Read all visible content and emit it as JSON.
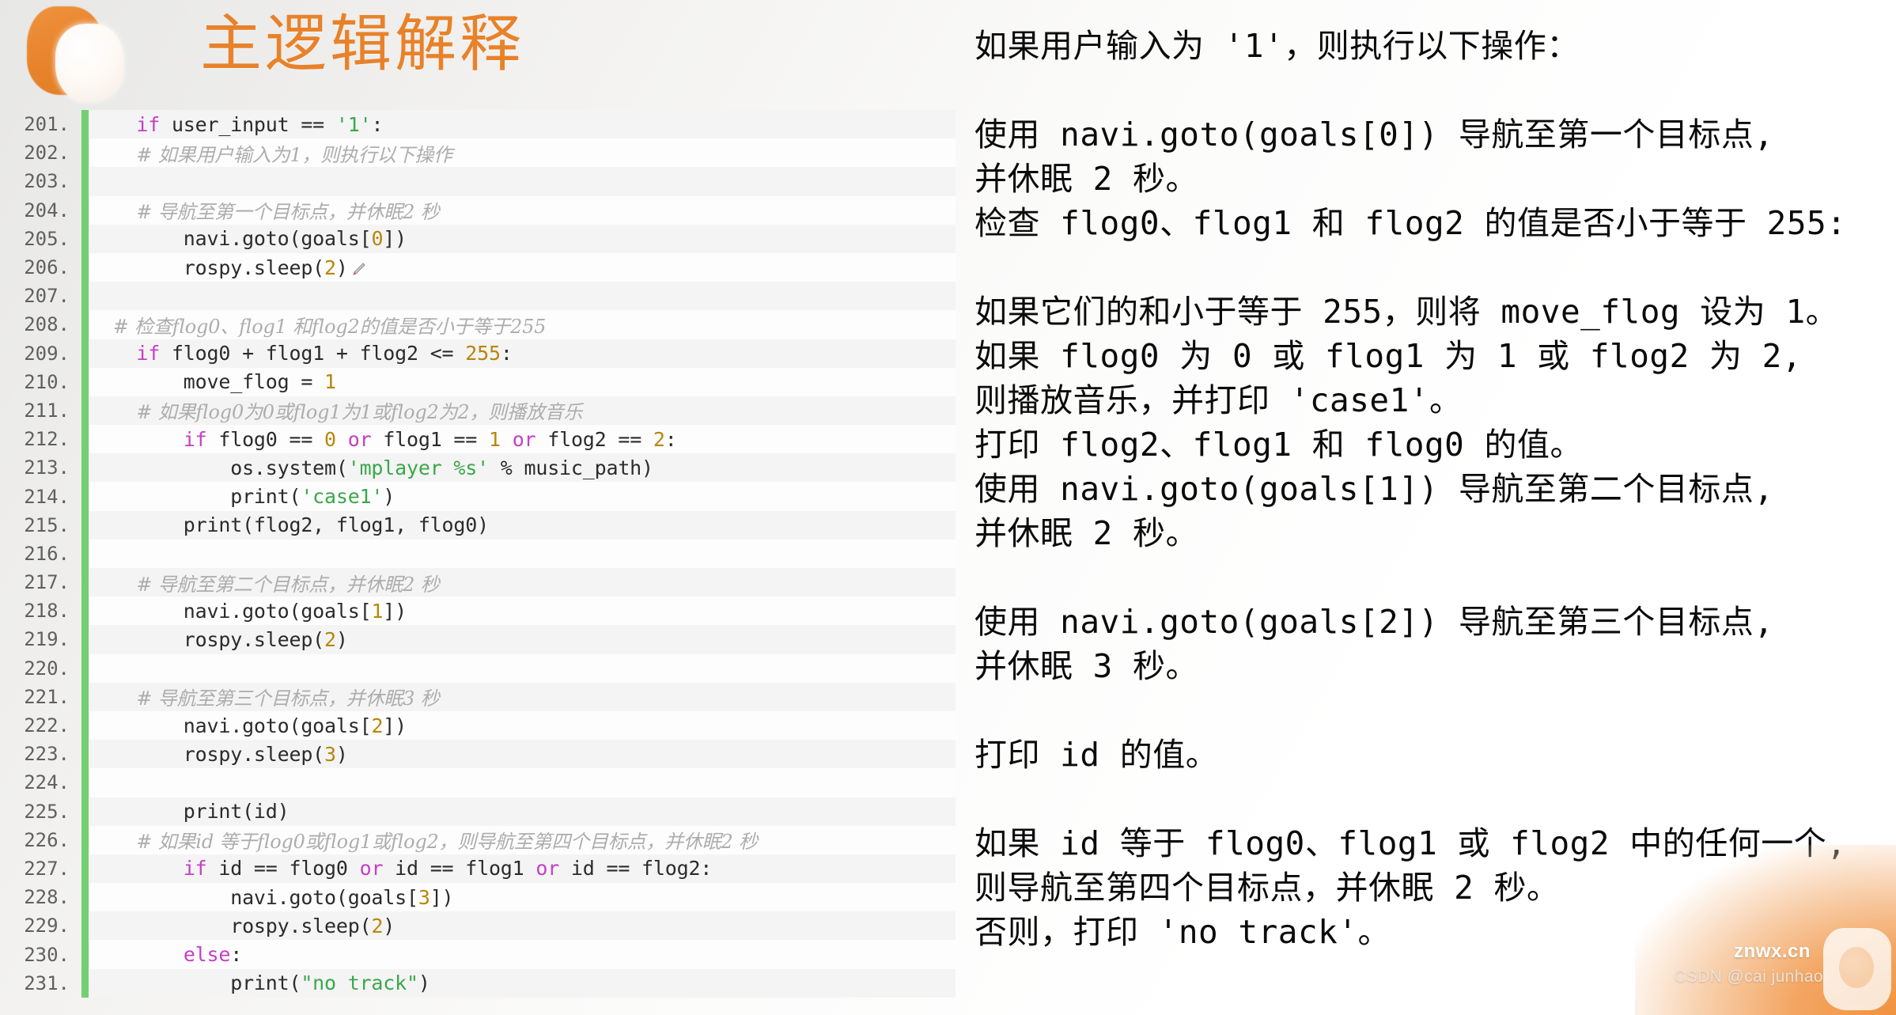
{
  "header": {
    "title": "主逻辑解释",
    "logo_icon": "hexagon-crescent-logo-icon"
  },
  "code": {
    "language": "python",
    "gutter_marker_color": "#73d06f",
    "keyword_color": "#c53fc5",
    "number_color": "#b8860b",
    "string_color": "#3aa84a",
    "comment_color": "#adadad",
    "lines": [
      {
        "num": "201.",
        "text": "    if user_input == '1':"
      },
      {
        "num": "202.",
        "text": "        # 如果用户输入为1，则执行以下操作"
      },
      {
        "num": "203.",
        "text": ""
      },
      {
        "num": "204.",
        "text": "        # 导航至第一个目标点，并休眠2 秒"
      },
      {
        "num": "205.",
        "text": "        navi.goto(goals[0])"
      },
      {
        "num": "206.",
        "text": "        rospy.sleep(2)"
      },
      {
        "num": "207.",
        "text": ""
      },
      {
        "num": "208.",
        "text": "    # 检查flog0、flog1 和flog2的值是否小于等于255"
      },
      {
        "num": "209.",
        "text": "    if flog0 + flog1 + flog2 <= 255:"
      },
      {
        "num": "210.",
        "text": "        move_flog = 1"
      },
      {
        "num": "211.",
        "text": "        # 如果flog0为0或flog1为1或flog2为2，则播放音乐"
      },
      {
        "num": "212.",
        "text": "        if flog0 == 0 or flog1 == 1 or flog2 == 2:"
      },
      {
        "num": "213.",
        "text": "            os.system('mplayer %s' % music_path)"
      },
      {
        "num": "214.",
        "text": "            print('case1')"
      },
      {
        "num": "215.",
        "text": "        print(flog2, flog1, flog0)"
      },
      {
        "num": "216.",
        "text": ""
      },
      {
        "num": "217.",
        "text": "        # 导航至第二个目标点，并休眠2 秒"
      },
      {
        "num": "218.",
        "text": "        navi.goto(goals[1])"
      },
      {
        "num": "219.",
        "text": "        rospy.sleep(2)"
      },
      {
        "num": "220.",
        "text": ""
      },
      {
        "num": "221.",
        "text": "        # 导航至第三个目标点，并休眠3 秒"
      },
      {
        "num": "222.",
        "text": "        navi.goto(goals[2])"
      },
      {
        "num": "223.",
        "text": "        rospy.sleep(3)"
      },
      {
        "num": "224.",
        "text": ""
      },
      {
        "num": "225.",
        "text": "        print(id)"
      },
      {
        "num": "226.",
        "text": "        # 如果id 等于flog0或flog1或flog2，则导航至第四个目标点，并休眠2 秒"
      },
      {
        "num": "227.",
        "text": "        if id == flog0 or id == flog1 or id == flog2:"
      },
      {
        "num": "228.",
        "text": "            navi.goto(goals[3])"
      },
      {
        "num": "229.",
        "text": "            rospy.sleep(2)"
      },
      {
        "num": "230.",
        "text": "        else:"
      },
      {
        "num": "231.",
        "text": "            print(\"no track\")"
      }
    ]
  },
  "explanation": {
    "blocks": [
      {
        "lines": [
          "如果用户输入为 '1'，则执行以下操作："
        ]
      },
      {
        "gap": true
      },
      {
        "lines": [
          "使用 navi.goto(goals[0]) 导航至第一个目标点,",
          "并休眠 2 秒。",
          "检查 flog0、flog1 和 flog2 的值是否小于等于 255:"
        ]
      },
      {
        "gap": true
      },
      {
        "lines": [
          "如果它们的和小于等于 255，则将 move_flog 设为 1。",
          "如果 flog0 为 0 或 flog1 为 1 或 flog2 为 2,",
          "则播放音乐，并打印 'case1'。",
          "打印 flog2、flog1 和 flog0 的值。",
          "使用 navi.goto(goals[1]) 导航至第二个目标点,",
          "并休眠 2 秒。"
        ]
      },
      {
        "gap": true
      },
      {
        "lines": [
          "使用 navi.goto(goals[2]) 导航至第三个目标点,",
          "并休眠 3 秒。"
        ]
      },
      {
        "gap": true
      },
      {
        "lines": [
          "打印 id 的值。"
        ]
      },
      {
        "gap": true
      },
      {
        "lines": [
          "如果 id 等于 flog0、flog1 或 flog2 中的任何一个,",
          "则导航至第四个目标点，并休眠 2 秒。",
          "否则，打印 'no track'。"
        ]
      }
    ]
  },
  "watermark": {
    "site": "znwx.cn",
    "credit": "CSDN @cai junhao"
  }
}
